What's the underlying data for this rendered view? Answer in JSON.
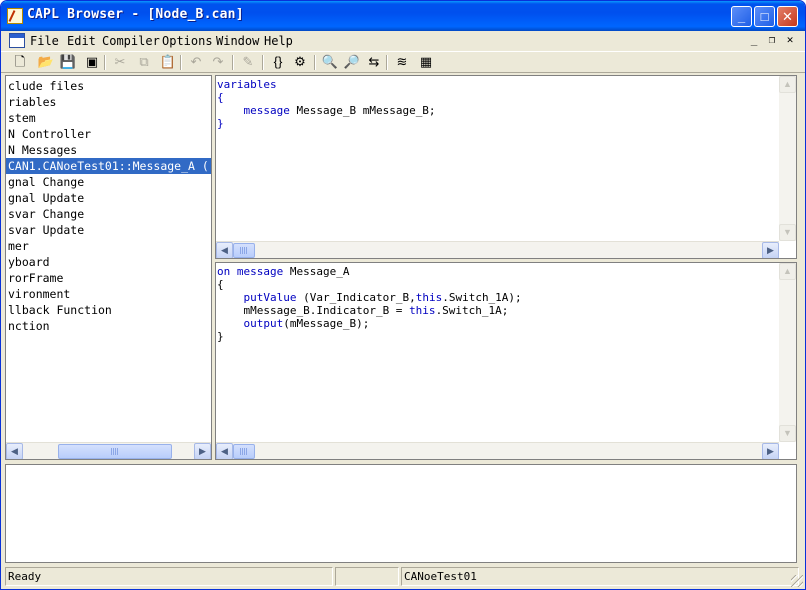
{
  "window": {
    "title": "CAPL Browser - [Node_B.can]",
    "controls": {
      "minimize": "_",
      "maximize": "□",
      "close": "✕"
    }
  },
  "menubar": {
    "items": [
      {
        "label": "File"
      },
      {
        "label": "Edit"
      },
      {
        "label": "Compiler"
      },
      {
        "label": "Options"
      },
      {
        "label": "Window"
      },
      {
        "label": "Help"
      }
    ],
    "mdi_controls": {
      "minimize": "_",
      "restore": "❐",
      "close": "✕"
    }
  },
  "toolbar": {
    "buttons": [
      {
        "name": "new",
        "icon": "new-file-icon",
        "glyph": "🗋",
        "enabled": true
      },
      {
        "name": "open",
        "icon": "open-folder-icon",
        "glyph": "📂",
        "enabled": true
      },
      {
        "name": "save",
        "icon": "save-icon",
        "glyph": "💾",
        "enabled": true
      },
      {
        "name": "save-all",
        "icon": "save-all-icon",
        "glyph": "▣",
        "enabled": true
      },
      {
        "name": "cut",
        "icon": "cut-icon",
        "glyph": "✂",
        "enabled": false
      },
      {
        "name": "copy",
        "icon": "copy-icon",
        "glyph": "⧉",
        "enabled": false
      },
      {
        "name": "paste",
        "icon": "paste-icon",
        "glyph": "📋",
        "enabled": false
      },
      {
        "name": "undo",
        "icon": "undo-icon",
        "glyph": "↶",
        "enabled": false
      },
      {
        "name": "redo",
        "icon": "redo-icon",
        "glyph": "↷",
        "enabled": false
      },
      {
        "name": "edit",
        "icon": "edit-icon",
        "glyph": "✎",
        "enabled": false
      },
      {
        "name": "compile",
        "icon": "compile-icon",
        "glyph": "{}",
        "enabled": true
      },
      {
        "name": "compile-all",
        "icon": "compile-all-icon",
        "glyph": "⚙",
        "enabled": true
      },
      {
        "name": "find",
        "icon": "binoculars-icon",
        "glyph": "🔍",
        "enabled": true
      },
      {
        "name": "find-next",
        "icon": "find-next-icon",
        "glyph": "🔎",
        "enabled": true
      },
      {
        "name": "replace",
        "icon": "replace-icon",
        "glyph": "⇆",
        "enabled": true
      },
      {
        "name": "stack",
        "icon": "layers-icon",
        "glyph": "≋",
        "enabled": true
      },
      {
        "name": "database",
        "icon": "database-icon",
        "glyph": "▦",
        "enabled": true
      }
    ]
  },
  "tree": {
    "items": [
      {
        "label": "clude files",
        "selected": false
      },
      {
        "label": "riables",
        "selected": false
      },
      {
        "label": "stem",
        "selected": false
      },
      {
        "label": "N Controller",
        "selected": false
      },
      {
        "label": "N Messages",
        "selected": false
      },
      {
        "label": "CAN1.CANoeTest01::Message_A (",
        "selected": true
      },
      {
        "label": "gnal Change",
        "selected": false
      },
      {
        "label": "gnal Update",
        "selected": false
      },
      {
        "label": "svar Change",
        "selected": false
      },
      {
        "label": "svar Update",
        "selected": false
      },
      {
        "label": "mer",
        "selected": false
      },
      {
        "label": "yboard",
        "selected": false
      },
      {
        "label": "rorFrame",
        "selected": false
      },
      {
        "label": "vironment",
        "selected": false
      },
      {
        "label": "llback Function",
        "selected": false
      },
      {
        "label": "nction",
        "selected": false
      }
    ]
  },
  "variables_editor": {
    "lines": [
      [
        {
          "t": "variables",
          "kw": true
        }
      ],
      [
        {
          "t": "{",
          "kw": true
        }
      ],
      [
        {
          "t": "    ",
          "kw": false
        },
        {
          "t": "message",
          "kw": true
        },
        {
          "t": " Message_B mMessage_B;",
          "kw": false
        }
      ],
      [
        {
          "t": "}",
          "kw": true
        }
      ]
    ]
  },
  "handler_editor": {
    "lines": [
      [
        {
          "t": "on message",
          "kw": true
        },
        {
          "t": " Message_A",
          "kw": false
        }
      ],
      [
        {
          "t": "{",
          "kw": false
        }
      ],
      [
        {
          "t": "    ",
          "kw": false
        },
        {
          "t": "putValue",
          "kw": true
        },
        {
          "t": " (Var_Indicator_B,",
          "kw": false
        },
        {
          "t": "this",
          "kw": true
        },
        {
          "t": ".Switch_1A);",
          "kw": false
        }
      ],
      [
        {
          "t": "    mMessage_B.Indicator_B = ",
          "kw": false
        },
        {
          "t": "this",
          "kw": true
        },
        {
          "t": ".Switch_1A;",
          "kw": false
        }
      ],
      [
        {
          "t": "    ",
          "kw": false
        },
        {
          "t": "output",
          "kw": true
        },
        {
          "t": "(mMessage_B);",
          "kw": false
        }
      ],
      [
        {
          "t": "}",
          "kw": false
        }
      ]
    ]
  },
  "statusbar": {
    "status": "Ready",
    "field2": "",
    "field3": "CANoeTest01"
  },
  "colors": {
    "keyword": "#0000c0",
    "selection": "#316ac5",
    "titlebar": "#0053ee"
  }
}
